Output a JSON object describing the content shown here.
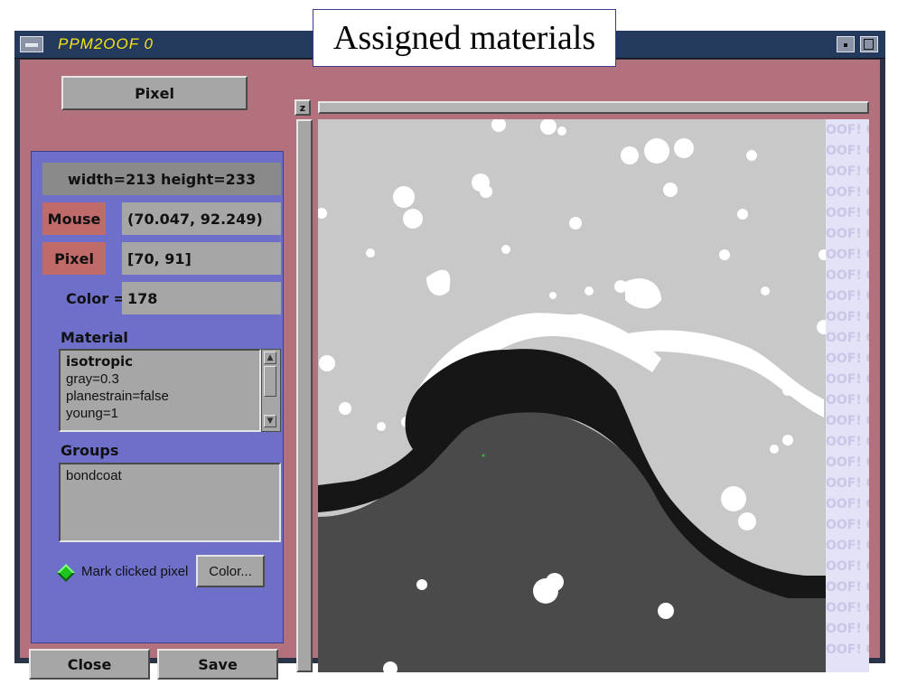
{
  "caption": "Assigned materials",
  "window": {
    "title": "PPM2OOF 0"
  },
  "left_panel": {
    "mode_button": "Pixel",
    "dimensions": "width=213  height=233",
    "mouse": {
      "label": "Mouse",
      "value": "(70.047, 92.249)"
    },
    "pixel": {
      "label": "Pixel",
      "value": "[70, 91]"
    },
    "color": {
      "label": "Color =",
      "value": "178"
    },
    "material": {
      "heading": "Material",
      "lines": [
        "isotropic",
        "gray=0.3",
        "planestrain=false",
        "young=1"
      ]
    },
    "groups": {
      "heading": "Groups",
      "lines": [
        "bondcoat"
      ]
    },
    "mark_clicked_pixel": {
      "label": "Mark clicked pixel",
      "checked": true
    },
    "color_button": "Color...",
    "close_button": "Close",
    "save_button": "Save"
  },
  "image_view": {
    "zoom_button": "z",
    "watermark_text": "OOF!  O"
  },
  "colors": {
    "window_bg": "#b2717c",
    "panel_bg": "#6e6fc8",
    "titlebar": "#243a5c",
    "title_text": "#f5e31a",
    "light_gray": "#c8c8c8",
    "dark_gray": "#4a4a4a",
    "black_band": "#161616",
    "white": "#ffffff",
    "watermark_bg": "#e4e2f6",
    "mark_indicator": "#1ec41e"
  }
}
